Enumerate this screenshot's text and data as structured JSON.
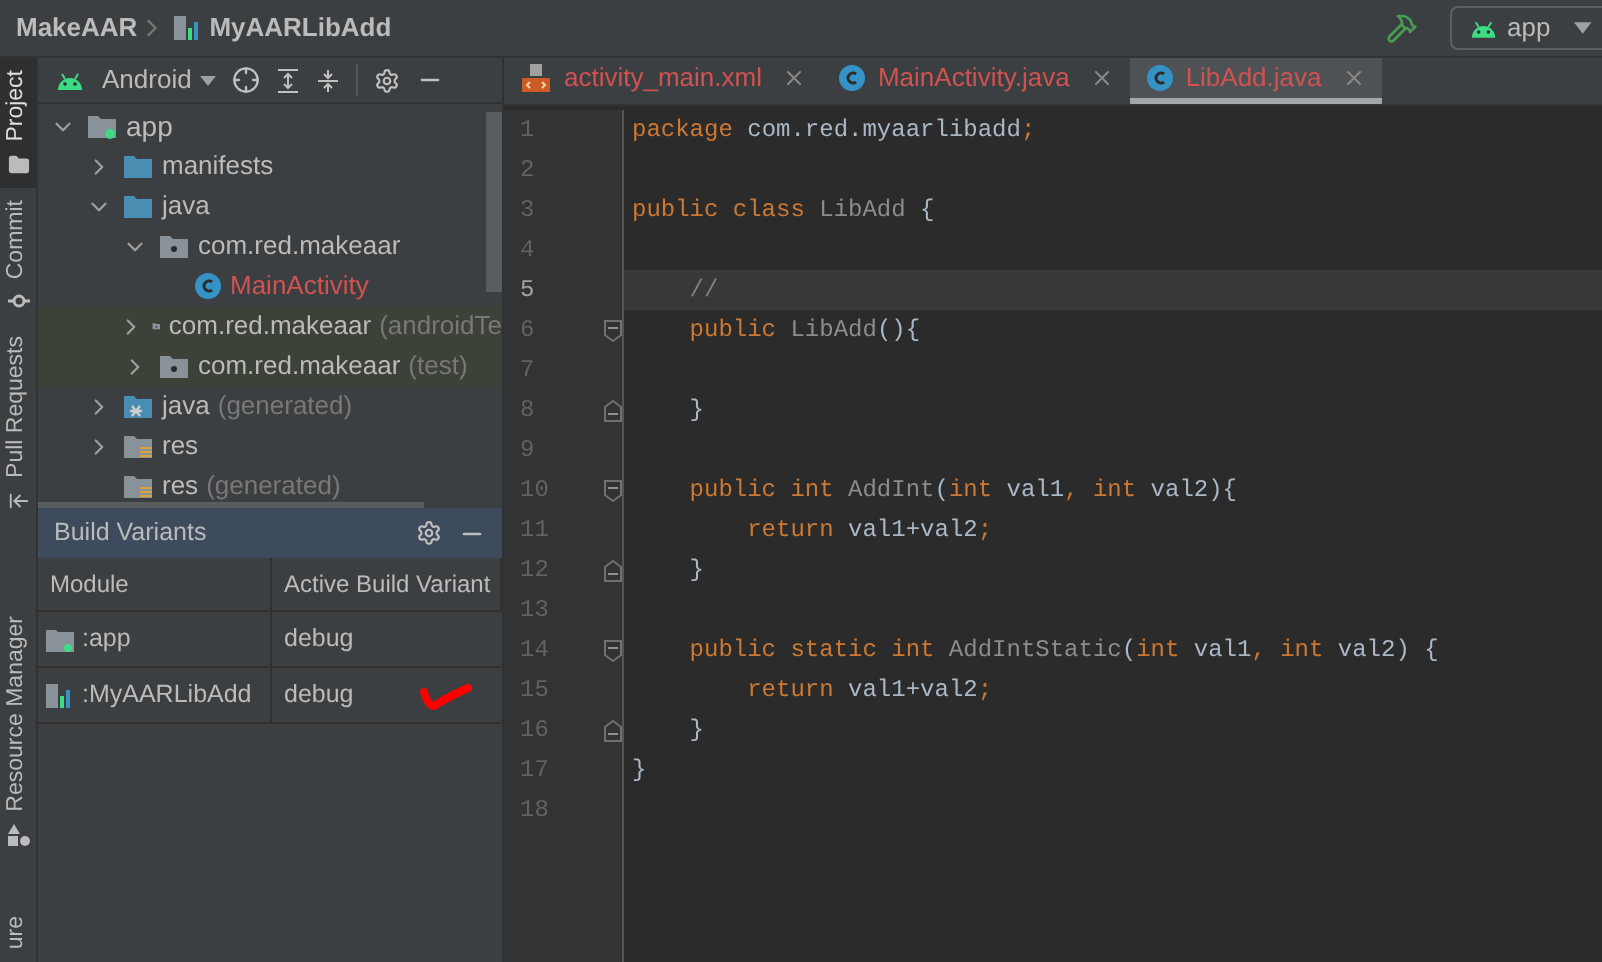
{
  "breadcrumbs": [
    {
      "label": "MakeAAR",
      "kind": "project"
    },
    {
      "label": "MyAARLibAdd",
      "kind": "module"
    }
  ],
  "run_config": {
    "label": "app"
  },
  "tool_strip": [
    {
      "label": "Project",
      "kind": "folder",
      "selected": true
    },
    {
      "label": "Commit",
      "kind": "commit",
      "selected": false
    },
    {
      "label": "Pull Requests",
      "kind": "pull",
      "selected": false
    },
    {
      "label": "Resource Manager",
      "kind": "resource",
      "selected": false
    },
    {
      "label": "ure",
      "kind": "none",
      "selected": false
    }
  ],
  "project_panel": {
    "view": "Android",
    "tree": [
      {
        "label": "app",
        "kind": "module",
        "expanded": true,
        "children": [
          {
            "label": "manifests",
            "kind": "folder",
            "expanded": false
          },
          {
            "label": "java",
            "kind": "folder",
            "expanded": true,
            "children": [
              {
                "label": "com.red.makeaar",
                "kind": "package",
                "expanded": true,
                "children": [
                  {
                    "label": "MainActivity",
                    "kind": "class"
                  }
                ]
              },
              {
                "label": "com.red.makeaar",
                "suffix": "(androidTe",
                "kind": "test-package",
                "expanded": false
              },
              {
                "label": "com.red.makeaar",
                "suffix": "(test)",
                "kind": "test-package",
                "expanded": false
              }
            ]
          },
          {
            "label": "java",
            "suffix": "(generated)",
            "kind": "generated-folder",
            "expanded": false
          },
          {
            "label": "res",
            "kind": "res-folder",
            "expanded": false
          },
          {
            "label": "res",
            "suffix": "(generated)",
            "kind": "res-folder"
          }
        ]
      }
    ]
  },
  "build_variants": {
    "title": "Build Variants",
    "columns": [
      "Module",
      "Active Build Variant"
    ],
    "rows": [
      {
        "module": ":app",
        "kind": "app",
        "variant": "debug",
        "annotated": false
      },
      {
        "module": ":MyAARLibAdd",
        "kind": "library",
        "variant": "debug",
        "annotated": true
      }
    ]
  },
  "tabs": [
    {
      "label": "activity_main.xml",
      "kind": "xml",
      "selected": false
    },
    {
      "label": "MainActivity.java",
      "kind": "class",
      "selected": false
    },
    {
      "label": "LibAdd.java",
      "kind": "class",
      "selected": true
    }
  ],
  "editor": {
    "lines": [
      {
        "number": "1",
        "current": false,
        "kind": "plain",
        "tokens": [
          {
            "text": "package",
            "kind": "keyword"
          },
          {
            "text": " com.red.myaarlibadd",
            "kind": "plain"
          },
          {
            "text": ";",
            "kind": "keyword"
          }
        ]
      },
      {
        "number": "2",
        "current": false,
        "kind": "plain"
      },
      {
        "number": "3",
        "current": false,
        "kind": "plain",
        "tokens": [
          {
            "text": "public class",
            "kind": "keyword"
          },
          {
            "text": " LibAdd",
            "kind": "name"
          },
          {
            "text": " {",
            "kind": "plain"
          }
        ]
      },
      {
        "number": "4",
        "current": false,
        "kind": "plain"
      },
      {
        "number": "5",
        "current": true,
        "kind": "plain",
        "tokens": [
          {
            "text": "    //",
            "kind": "comment"
          }
        ]
      },
      {
        "number": "6",
        "current": false,
        "kind": "fold-start",
        "tokens": [
          {
            "text": "    public",
            "kind": "keyword"
          },
          {
            "text": " LibAdd",
            "kind": "name"
          },
          {
            "text": "(){",
            "kind": "plain"
          }
        ]
      },
      {
        "number": "7",
        "current": false,
        "kind": "plain"
      },
      {
        "number": "8",
        "current": false,
        "kind": "fold-end",
        "tokens": [
          {
            "text": "    }",
            "kind": "plain"
          }
        ]
      },
      {
        "number": "9",
        "current": false,
        "kind": "plain"
      },
      {
        "number": "10",
        "current": false,
        "kind": "fold-start",
        "tokens": [
          {
            "text": "    public int",
            "kind": "keyword"
          },
          {
            "text": " AddInt",
            "kind": "name"
          },
          {
            "text": "(",
            "kind": "plain"
          },
          {
            "text": "int",
            "kind": "keyword"
          },
          {
            "text": " val1",
            "kind": "plain"
          },
          {
            "text": ", int",
            "kind": "keyword"
          },
          {
            "text": " val2){",
            "kind": "plain"
          }
        ]
      },
      {
        "number": "11",
        "current": false,
        "kind": "plain",
        "tokens": [
          {
            "text": "        return",
            "kind": "keyword"
          },
          {
            "text": " val1+val2",
            "kind": "plain"
          },
          {
            "text": ";",
            "kind": "keyword"
          }
        ]
      },
      {
        "number": "12",
        "current": false,
        "kind": "fold-end",
        "tokens": [
          {
            "text": "    }",
            "kind": "plain"
          }
        ]
      },
      {
        "number": "13",
        "current": false,
        "kind": "plain"
      },
      {
        "number": "14",
        "current": false,
        "kind": "fold-start",
        "tokens": [
          {
            "text": "    public static int",
            "kind": "keyword"
          },
          {
            "text": " AddIntStatic",
            "kind": "name"
          },
          {
            "text": "(",
            "kind": "plain"
          },
          {
            "text": "int",
            "kind": "keyword"
          },
          {
            "text": " val1",
            "kind": "plain"
          },
          {
            "text": ", int",
            "kind": "keyword"
          },
          {
            "text": " val2) {",
            "kind": "plain"
          }
        ]
      },
      {
        "number": "15",
        "current": false,
        "kind": "plain",
        "tokens": [
          {
            "text": "        return",
            "kind": "keyword"
          },
          {
            "text": " val1+val2",
            "kind": "plain"
          },
          {
            "text": ";",
            "kind": "keyword"
          }
        ]
      },
      {
        "number": "16",
        "current": false,
        "kind": "fold-end",
        "tokens": [
          {
            "text": "    }",
            "kind": "plain"
          }
        ]
      },
      {
        "number": "17",
        "current": false,
        "kind": "plain",
        "tokens": [
          {
            "text": "}",
            "kind": "plain"
          }
        ]
      },
      {
        "number": "18",
        "current": false,
        "kind": "plain"
      }
    ]
  }
}
